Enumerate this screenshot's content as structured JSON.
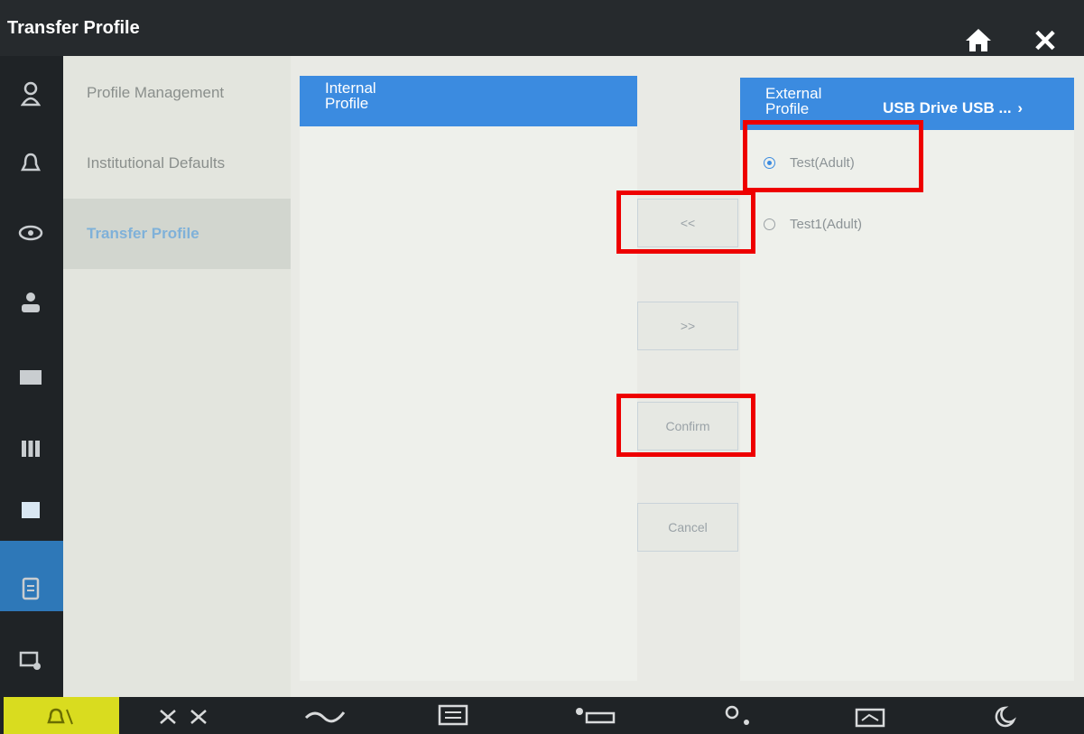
{
  "window": {
    "title": "Transfer Profile"
  },
  "nav": {
    "items": [
      {
        "label": "Profile Management"
      },
      {
        "label": "Institutional Defaults"
      },
      {
        "label": "Transfer Profile"
      }
    ]
  },
  "internal": {
    "header_line1": "Internal",
    "header_line2": "Profile"
  },
  "external": {
    "header_line1": "External",
    "header_line2": "Profile",
    "source": "USB Drive USB ...",
    "chevron": "›",
    "profiles": [
      {
        "label": "Test(Adult)",
        "selected": true
      },
      {
        "label": "Test1(Adult)",
        "selected": false
      }
    ]
  },
  "buttons": {
    "import": "<<",
    "export": ">>",
    "confirm": "Confirm",
    "cancel": "Cancel"
  },
  "icons": {
    "close": "✕",
    "left_sidebar": [
      "person-icon",
      "bell-icon",
      "eye-icon",
      "patient-icon",
      "monitor-icon",
      "grid-icon",
      "screen-icon",
      "document-icon",
      "device-settings-icon"
    ],
    "bottom_bar": [
      "alarm-pause-icon",
      "alarm-off-icon",
      "pump-icon",
      "layout-icon",
      "patient-bed-icon",
      "user-icon",
      "screen-icon",
      "night-mode-icon"
    ]
  },
  "colors": {
    "accent": "#3b8be0",
    "highlight": "#ee0000",
    "active_bottom": "#d9dc1f"
  }
}
